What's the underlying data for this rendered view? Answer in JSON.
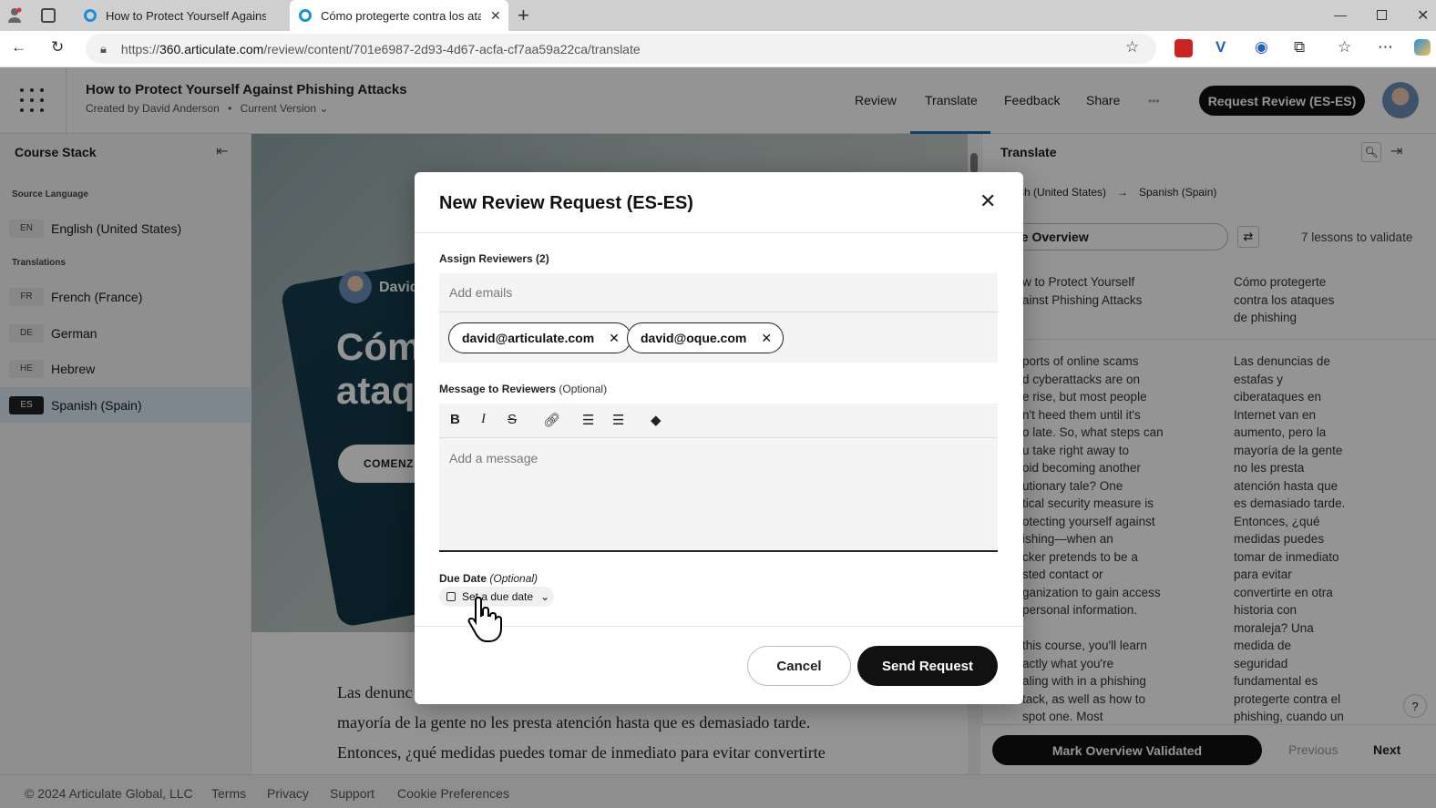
{
  "browser": {
    "tabs": [
      {
        "title": "How to Protect Yourself Against Phishing Attacks"
      },
      {
        "title": "Cómo protegerte contra los ataques de phishing"
      }
    ],
    "url_scheme": "https://",
    "url_host": "360.articulate.com",
    "url_path": "/review/content/701e6987-2d93-4d67-acfa-cf7aa59a22ca/translate"
  },
  "app": {
    "title": "How to Protect Yourself Against Phishing Attacks",
    "created_by": "Created by David Anderson",
    "bullet": "•",
    "version": "Current Version",
    "nav": [
      "Review",
      "Translate",
      "Feedback",
      "Share"
    ],
    "more": "•••",
    "request_button": "Request Review (ES-ES)"
  },
  "sidebar": {
    "title": "Course Stack",
    "source_label": "Source Language",
    "source": {
      "code": "EN",
      "name": "English (United States)"
    },
    "translations_label": "Translations",
    "translations": [
      {
        "code": "FR",
        "name": "French (France)"
      },
      {
        "code": "DE",
        "name": "German"
      },
      {
        "code": "HE",
        "name": "Hebrew"
      },
      {
        "code": "ES",
        "name": "Spanish (Spain)",
        "selected": true
      }
    ]
  },
  "content": {
    "hero_name": "David",
    "hero_line1": "Cóm",
    "hero_line2": "ataq",
    "hero_button": "COMENZ",
    "body_lines": [
      "Las denunc",
      "mayoría de la gente no les presta atención hasta que es demasiado tarde.",
      "Entonces, ¿qué medidas puedes tomar de inmediato para evitar convertirte"
    ]
  },
  "translate_panel": {
    "title": "Translate",
    "from_lang": "sh (United States)",
    "arrow": "→",
    "to_lang": "Spanish (Spain)",
    "section": "urse Overview",
    "lessons": "7 lessons to validate",
    "source_title": [
      "w to Protect Yourself",
      "ainst Phishing Attacks"
    ],
    "target_title": [
      "Cómo protegerte",
      "contra los ataques",
      "de phishing"
    ],
    "source_body": [
      "ports of online scams",
      "d cyberattacks are on",
      "e rise, but most people",
      "n't heed them until it's",
      "o late. So, what steps can",
      "u take right away to",
      "oid becoming another",
      "utionary tale? One",
      "tical security measure is",
      "otecting yourself against",
      "ishing—when an",
      "cker pretends to be a",
      "sted contact or",
      "ganization to gain access",
      "personal information.",
      "",
      "this course, you'll learn",
      "actly what you're",
      "aling with in a phishing",
      "tack, as well as how to",
      "spot one. Most"
    ],
    "target_body": [
      "Las denuncias de",
      "estafas y",
      "ciberataques en",
      "Internet van en",
      "aumento, pero la",
      "mayoría de la gente",
      "no les presta",
      "atención hasta que",
      "es demasiado tarde.",
      "Entonces, ¿qué",
      "medidas puedes",
      "tomar de inmediato",
      "para evitar",
      "convertirte en otra",
      "historia con",
      "moraleja? Una",
      "medida de",
      "seguridad",
      "fundamental es",
      "protegerte contra el",
      "phishing, cuando un"
    ],
    "mark_button": "Mark Overview Validated",
    "previous": "Previous",
    "next": "Next",
    "help": "?"
  },
  "footer": {
    "copyright": "© 2024 Articulate Global, LLC",
    "links": [
      "Terms",
      "Privacy",
      "Support",
      "Cookie Preferences"
    ]
  },
  "modal": {
    "title": "New Review Request (ES-ES)",
    "close": "✕",
    "assign_label": "Assign Reviewers (2)",
    "email_placeholder": "Add emails",
    "reviewers": [
      "david@articulate.com",
      "david@oque.com"
    ],
    "message_label": "Message to Reviewers",
    "optional": "(Optional)",
    "message_placeholder": "Add a message",
    "due_label": "Due Date",
    "due_button": "Set a due date",
    "cancel": "Cancel",
    "send": "Send Request"
  }
}
